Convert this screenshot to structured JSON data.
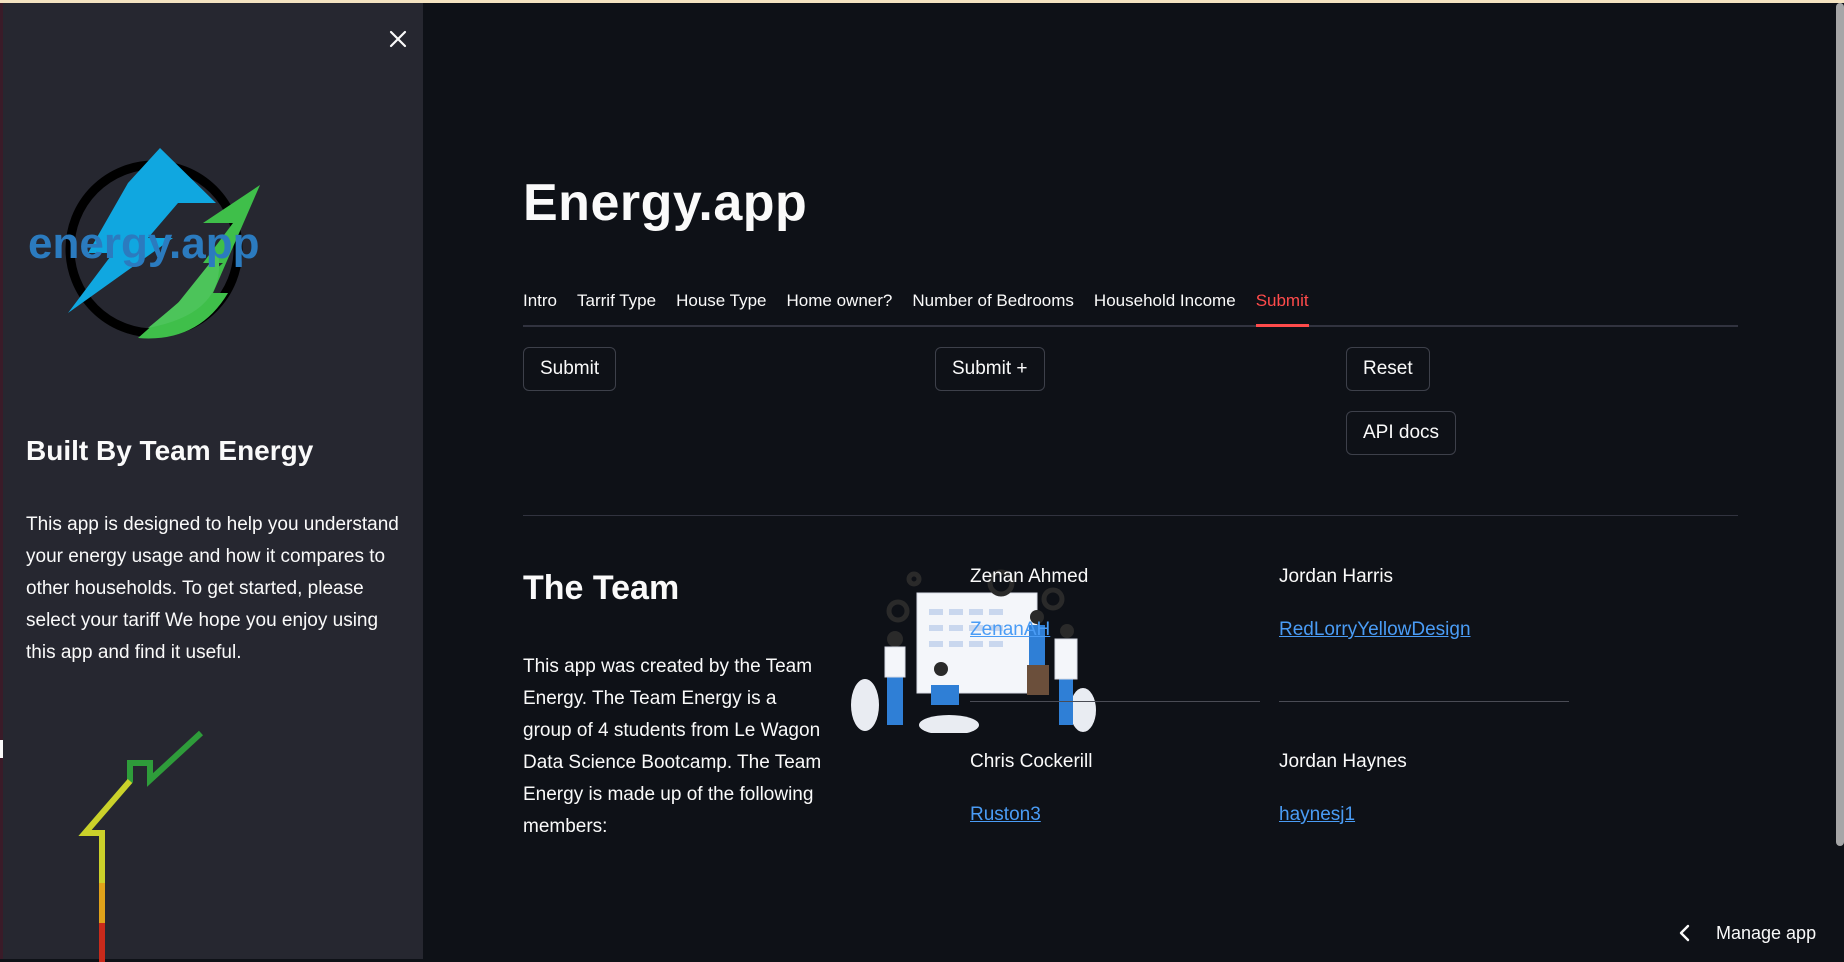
{
  "sidebar": {
    "logo_text": "energy.app",
    "title": "Built By Team Energy",
    "description": "This app is designed to help you understand your energy usage and how it compares to other households. To get started, please select your tariff We hope you enjoy using this app and find it useful.",
    "close_icon": "close-icon"
  },
  "main": {
    "title": "Energy.app",
    "tabs": [
      {
        "label": "Intro"
      },
      {
        "label": "Tarrif Type"
      },
      {
        "label": "House Type"
      },
      {
        "label": "Home owner?"
      },
      {
        "label": "Number of Bedrooms"
      },
      {
        "label": "Household Income"
      },
      {
        "label": "Submit"
      }
    ],
    "active_tab": "Submit",
    "buttons": {
      "submit": "Submit",
      "submit_plus": "Submit +",
      "reset": "Reset",
      "api_docs": "API docs"
    },
    "team": {
      "title": "The Team",
      "description": "This app was created by the Team Energy. The Team Energy is a group of 4 students from Le Wagon Data Science Bootcamp. The Team Energy is made up of the following members:",
      "members": [
        {
          "name": "Zenan Ahmed",
          "link": "ZenanAH"
        },
        {
          "name": "Jordan Harris",
          "link": "RedLorryYellowDesign"
        },
        {
          "name": "Chris Cockerill",
          "link": "Ruston3"
        },
        {
          "name": "Jordan Haynes",
          "link": "haynesj1"
        }
      ]
    }
  },
  "footer": {
    "manage_app": "Manage app"
  },
  "colors": {
    "background": "#0e1117",
    "sidebar": "#262730",
    "accent": "#ff4b4b",
    "link": "#4a9cf5"
  }
}
